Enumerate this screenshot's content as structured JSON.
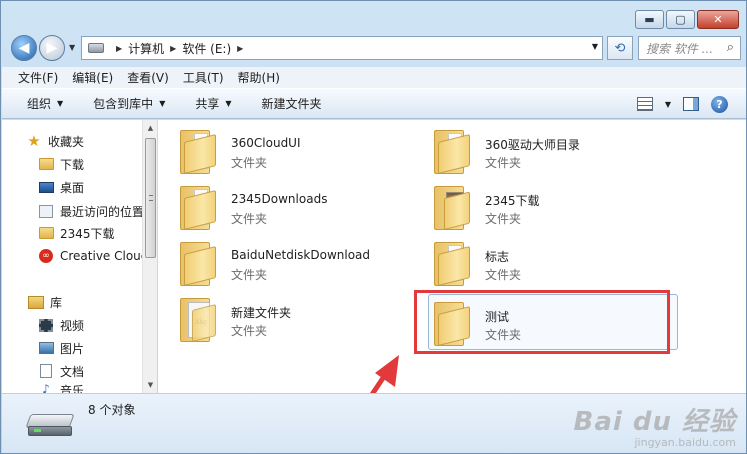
{
  "window": {
    "caption": {
      "minimize": "▬",
      "maximize": "▢",
      "close": "✕"
    }
  },
  "address": {
    "crumbs": [
      "计算机",
      "软件 (E:)"
    ]
  },
  "search": {
    "placeholder": "搜索 软件 ..."
  },
  "menu": [
    "文件(F)",
    "编辑(E)",
    "查看(V)",
    "工具(T)",
    "帮助(H)"
  ],
  "commands": {
    "organize": "组织",
    "include_in_library": "包含到库中",
    "share": "共享",
    "new_folder": "新建文件夹"
  },
  "nav": {
    "favorites": "收藏夹",
    "downloads": "下载",
    "desktop": "桌面",
    "recent": "最近访问的位置",
    "dl2345": "2345下载",
    "creative_cloud": "Creative Cloud",
    "libraries": "库",
    "videos": "视频",
    "pictures": "图片",
    "documents": "文档",
    "music": "音乐"
  },
  "items": [
    {
      "name": "360CloudUI",
      "type": "文件夹",
      "icon": "folder-icon"
    },
    {
      "name": "360驱动大师目录",
      "type": "文件夹",
      "icon": "folder-icon"
    },
    {
      "name": "2345Downloads",
      "type": "文件夹",
      "icon": "folder-icon"
    },
    {
      "name": "2345下载",
      "type": "文件夹",
      "icon": "folder-photo-icon"
    },
    {
      "name": "BaiduNetdiskDownload",
      "type": "文件夹",
      "icon": "folder-icon"
    },
    {
      "name": "标志",
      "type": "文件夹",
      "icon": "folder-icon"
    },
    {
      "name": "新建文件夹",
      "type": "文件夹",
      "icon": "folder-image-icon"
    },
    {
      "name": "测试",
      "type": "文件夹",
      "icon": "folder-icon"
    }
  ],
  "details": {
    "count": "8 个对象"
  },
  "watermark": {
    "line1": "Bai du 经验",
    "line2": "jingyan.baidu.com"
  },
  "colors": {
    "highlight_box": "#e23a3a",
    "selection_border": "#98b6d6"
  }
}
